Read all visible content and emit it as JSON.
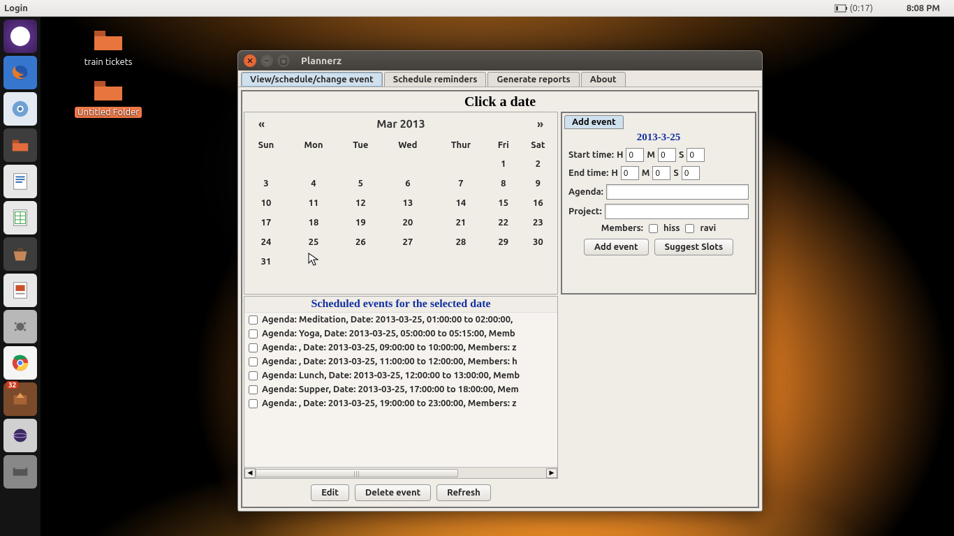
{
  "menubar": {
    "left": "Login",
    "battery": "(0:17)",
    "clock": "8:08 PM"
  },
  "launcher": {
    "updates_badge": "32"
  },
  "desktop_icons": [
    {
      "label": "train tickets",
      "selected": false
    },
    {
      "label": "Untitled Folder",
      "selected": true
    }
  ],
  "window": {
    "title": "Plannerz",
    "tabs": [
      "View/schedule/change event",
      "Schedule reminders",
      "Generate reports",
      "About"
    ],
    "active_tab": 0,
    "header": "Click a date",
    "calendar": {
      "prev": "«",
      "next": "»",
      "month_label": "Mar 2013",
      "day_headers": [
        "Sun",
        "Mon",
        "Tue",
        "Wed",
        "Thur",
        "Fri",
        "Sat"
      ],
      "weeks": [
        [
          "",
          "",
          "",
          "",
          "",
          "1",
          "2"
        ],
        [
          "3",
          "4",
          "5",
          "6",
          "7",
          "8",
          "9"
        ],
        [
          "10",
          "11",
          "12",
          "13",
          "14",
          "15",
          "16"
        ],
        [
          "17",
          "18",
          "19",
          "20",
          "21",
          "22",
          "23"
        ],
        [
          "24",
          "25",
          "26",
          "27",
          "28",
          "29",
          "30"
        ],
        [
          "31",
          "",
          "",
          "",
          "",
          "",
          ""
        ]
      ]
    },
    "form": {
      "tab_label": "Add event",
      "date": "2013-3-25",
      "start_label": "Start time:",
      "end_label": "End time:",
      "h": "H",
      "m": "M",
      "s": "S",
      "m2": "M",
      "s2": "S",
      "h2": "H",
      "start_h": "0",
      "start_m": "0",
      "start_s": "0",
      "end_h": "0",
      "end_m": "0",
      "end_s": "0",
      "agenda_label": "Agenda:",
      "project_label": "Project:",
      "members_label": "Members:",
      "member1": "hiss",
      "member2": "ravi",
      "add_btn": "Add event",
      "suggest_btn": "Suggest Slots"
    },
    "events": {
      "header": "Scheduled events for the selected date",
      "rows": [
        "Agenda: Meditation, Date: 2013-03-25, 01:00:00 to 02:00:00, ",
        "Agenda: Yoga, Date: 2013-03-25, 05:00:00 to 05:15:00, Memb",
        "Agenda: , Date: 2013-03-25, 09:00:00 to 10:00:00, Members: z",
        "Agenda: , Date: 2013-03-25, 11:00:00 to 12:00:00, Members: h",
        "Agenda: Lunch, Date: 2013-03-25, 12:00:00 to 13:00:00, Memb",
        "Agenda: Supper, Date: 2013-03-25, 17:00:00 to 18:00:00, Mem",
        "Agenda: , Date: 2013-03-25, 19:00:00 to 23:00:00, Members: z"
      ]
    },
    "bottom_buttons": {
      "edit": "Edit",
      "delete": "Delete event",
      "refresh": "Refresh"
    }
  }
}
